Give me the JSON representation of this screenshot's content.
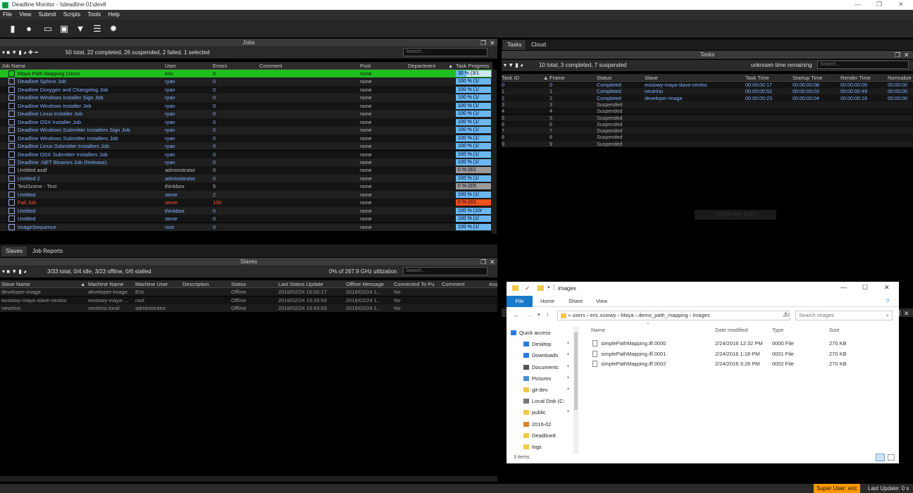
{
  "window": {
    "title": "Deadline Monitor  -  \\\\deadline-01\\dev8",
    "controls": [
      "—",
      "❐",
      "✕"
    ]
  },
  "menu": [
    "File",
    "View",
    "Submit",
    "Scripts",
    "Tools",
    "Help"
  ],
  "jobs_panel": {
    "title": "Jobs",
    "summary": "50 total, 22 completed, 26 suspended, 2 failed, 1 selected",
    "search_placeholder": "Search...",
    "columns": [
      "Job Name",
      "User",
      "Errors",
      "Comment",
      "Pool",
      "Department",
      "Task Progress"
    ],
    "rows": [
      {
        "name": "Maya Path Mapping Demo",
        "user": "eric",
        "errors": "0",
        "pool": "none",
        "progress": "30 %  (3/1",
        "pct": 30,
        "state": "selected"
      },
      {
        "name": "Deadline Sphinx Job",
        "user": "ryan",
        "errors": "0",
        "pool": "none",
        "progress": "100 %  (1/",
        "pct": 100,
        "state": "done"
      },
      {
        "name": "Deadline Doxygen and Changelog Job",
        "user": "ryan",
        "errors": "0",
        "pool": "none",
        "progress": "100 %  (1/",
        "pct": 100,
        "state": "done"
      },
      {
        "name": "Deadline Windows Installer Sign Job",
        "user": "ryan",
        "errors": "0",
        "pool": "none",
        "progress": "100 %  (1/",
        "pct": 100,
        "state": "done"
      },
      {
        "name": "Deadline Windows Installer Job",
        "user": "ryan",
        "errors": "0",
        "pool": "none",
        "progress": "100 %  (1/",
        "pct": 100,
        "state": "done"
      },
      {
        "name": "Deadline Linux Installer Job",
        "user": "ryan",
        "errors": "0",
        "pool": "none",
        "progress": "100 %  (1/",
        "pct": 100,
        "state": "done"
      },
      {
        "name": "Deadline OSX Installer Job",
        "user": "ryan",
        "errors": "0",
        "pool": "none",
        "progress": "100 %  (1/",
        "pct": 100,
        "state": "done"
      },
      {
        "name": "Deadline Windows Submitter Installers Sign Job",
        "user": "ryan",
        "errors": "0",
        "pool": "none",
        "progress": "100 %  (1/",
        "pct": 100,
        "state": "done"
      },
      {
        "name": "Deadline Windows Submitter Installers Job",
        "user": "ryan",
        "errors": "0",
        "pool": "none",
        "progress": "100 %  (1/",
        "pct": 100,
        "state": "done"
      },
      {
        "name": "Deadline Linux Submitter Installers Job",
        "user": "ryan",
        "errors": "0",
        "pool": "none",
        "progress": "100 %  (1/",
        "pct": 100,
        "state": "done"
      },
      {
        "name": "Deadline OSX Submitter Installers Job",
        "user": "ryan",
        "errors": "0",
        "pool": "none",
        "progress": "100 %  (1/",
        "pct": 100,
        "state": "done"
      },
      {
        "name": "Deadline .NET Binaries Job (Release)",
        "user": "ryan",
        "errors": "0",
        "pool": "none",
        "progress": "100 %  (1/",
        "pct": 100,
        "state": "done"
      },
      {
        "name": "Untitled asdf",
        "user": "administrator",
        "errors": "0",
        "pool": "none",
        "progress": "0 %  (0/1",
        "pct": 0,
        "state": "suspended"
      },
      {
        "name": "Untitled 2",
        "user": "administrator",
        "errors": "0",
        "pool": "none",
        "progress": "100 %  (1/",
        "pct": 100,
        "state": "done"
      },
      {
        "name": "TestScene - Test",
        "user": "thinkbox",
        "errors": "5",
        "pool": "none",
        "progress": "0 %  (0/5",
        "pct": 0,
        "state": "suspended"
      },
      {
        "name": "Untitled",
        "user": "steve",
        "errors": "2",
        "pool": "none",
        "progress": "100 %  (1/",
        "pct": 100,
        "state": "done"
      },
      {
        "name": "Fail Job",
        "user": "steve",
        "errors": "100",
        "pool": "none",
        "progress": "0 %  (0/1",
        "pct": 0,
        "state": "failed"
      },
      {
        "name": "Untitled",
        "user": "thinkbox",
        "errors": "0",
        "pool": "none",
        "progress": "100 %  (10/",
        "pct": 100,
        "state": "done"
      },
      {
        "name": "Untitled",
        "user": "steve",
        "errors": "0",
        "pool": "none",
        "progress": "100 %  (1/",
        "pct": 100,
        "state": "done"
      },
      {
        "name": "ImageSequence",
        "user": "root",
        "errors": "0",
        "pool": "none",
        "progress": "100 %  (1/",
        "pct": 100,
        "state": "done"
      }
    ]
  },
  "bottom_tabs": [
    "Slaves",
    "Job Reports"
  ],
  "slaves_panel": {
    "title": "Slaves",
    "summary": "3/33 total, 0/4 idle, 3/23 offline, 0/6 stalled",
    "utilization": "0% of 267.9 GHz utilization",
    "search_placeholder": "Search...",
    "columns": [
      "Slave Name",
      "Machine Name",
      "Machine User",
      "Description",
      "Status",
      "Last Status Update",
      "Offline Message",
      "Connected To Pu",
      "Comment",
      "Ass"
    ],
    "rows": [
      {
        "name": "developer-image",
        "machine": "developer-image",
        "user": "Eric",
        "status": "Offline",
        "last": "2016/02/24 16:00:17",
        "offline": "2016/02/24 1...",
        "conn": "No"
      },
      {
        "name": "eosiowy-maya-slave-centos",
        "machine": "eosiowy-maya-...",
        "user": "root",
        "status": "Offline",
        "last": "2016/02/24 13:33:53",
        "offline": "2016/02/24 1...",
        "conn": "No"
      },
      {
        "name": "neutrino",
        "machine": "neutrino.local",
        "user": "administrator",
        "status": "Offline",
        "last": "2016/02/24 13:43:53",
        "offline": "2016/02/24 1...",
        "conn": "No"
      }
    ]
  },
  "tasks_panel": {
    "tabs": [
      "Tasks",
      "Cloud"
    ],
    "title": "Tasks",
    "summary": "10 total, 3 completed, 7 suspended",
    "time_remaining": "unknown time remaining",
    "search_placeholder": "Search...",
    "columns": [
      "Task ID",
      "Frame",
      "Status",
      "Slave",
      "Task Time",
      "Startup Time",
      "Render Time",
      "Normalize"
    ],
    "rows": [
      {
        "id": "0",
        "frame": "0",
        "status": "Completed",
        "slave": "eosiowy-maya-slave-centos",
        "task": "00:00:00:17",
        "startup": "00:00:00:08",
        "render": "00:00:00:09",
        "norm": "00:00:00"
      },
      {
        "id": "1",
        "frame": "1",
        "status": "Completed",
        "slave": "neutrino",
        "task": "00:00:00:52",
        "startup": "00:00:00:03",
        "render": "00:00:00:49",
        "norm": "00:00:00"
      },
      {
        "id": "2",
        "frame": "2",
        "status": "Completed",
        "slave": "developer-image",
        "task": "00:00:00:23",
        "startup": "00:00:00:04",
        "render": "00:00:00:18",
        "norm": "00:00:00"
      },
      {
        "id": "3",
        "frame": "3",
        "status": "Suspended",
        "slave": "",
        "task": "",
        "startup": "",
        "render": "",
        "norm": ""
      },
      {
        "id": "4",
        "frame": "4",
        "status": "Suspended",
        "slave": "",
        "task": "",
        "startup": "",
        "render": "",
        "norm": ""
      },
      {
        "id": "5",
        "frame": "5",
        "status": "Suspended",
        "slave": "",
        "task": "",
        "startup": "",
        "render": "",
        "norm": ""
      },
      {
        "id": "6",
        "frame": "6",
        "status": "Suspended",
        "slave": "",
        "task": "",
        "startup": "",
        "render": "",
        "norm": ""
      },
      {
        "id": "7",
        "frame": "7",
        "status": "Suspended",
        "slave": "",
        "task": "",
        "startup": "",
        "render": "",
        "norm": ""
      },
      {
        "id": "8",
        "frame": "8",
        "status": "Suspended",
        "slave": "",
        "task": "",
        "startup": "",
        "render": "",
        "norm": ""
      },
      {
        "id": "9",
        "frame": "9",
        "status": "Suspended",
        "slave": "",
        "task": "",
        "startup": "",
        "render": "",
        "norm": ""
      }
    ],
    "overlay_button": "Full-screen Stop"
  },
  "explorer": {
    "title": "images",
    "ribbon": [
      "File",
      "Home",
      "Share",
      "View"
    ],
    "address": [
      "«",
      "users",
      "›",
      "eric.osiowy",
      "›",
      "Maya",
      "›",
      "demo_path_mapping",
      "›",
      "images"
    ],
    "search_placeholder": "Search images",
    "nav": [
      "Quick access",
      "Desktop",
      "Downloads",
      "Documents",
      "Pictures",
      "git-dev",
      "Local Disk (C:",
      "public",
      "2016-02",
      "Deadline8",
      "logs"
    ],
    "columns": [
      "Name",
      "Date modified",
      "Type",
      "Size"
    ],
    "files": [
      {
        "name": "simplePathMapping.iff.0000",
        "date": "2/24/2016 12:32 PM",
        "type": "0000 File",
        "size": "270 KB"
      },
      {
        "name": "simplePathMapping.iff.0001",
        "date": "2/24/2016 1:18 PM",
        "type": "0001 File",
        "size": "270 KB"
      },
      {
        "name": "simplePathMapping.iff.0002",
        "date": "2/24/2016 3:28 PM",
        "type": "0002 File",
        "size": "270 KB"
      }
    ],
    "item_count": "3 items"
  },
  "statusbar": {
    "user": "Super User: eric",
    "last_update": "Last Update: 0 s"
  },
  "colors": {
    "selected_row": "#1fbf1f",
    "progress_done": "#6ab7f0",
    "progress_failed": "#f0501e",
    "progress_suspended": "#9a9a9a",
    "text_done": "#7fb2ff",
    "text_failed": "#ff5533",
    "text_suspended": "#bbbbbb",
    "accent": "#ff9900"
  }
}
